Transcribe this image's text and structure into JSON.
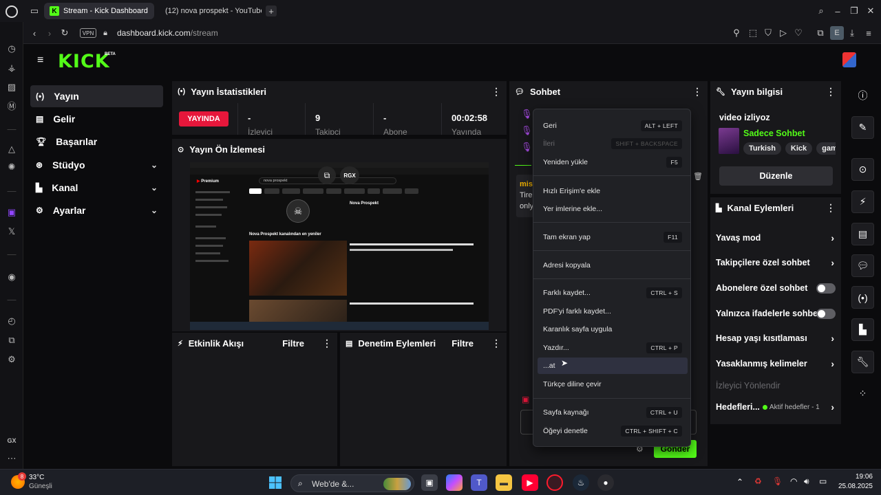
{
  "browser": {
    "tabs": [
      {
        "title": "Stream - Kick Dashboard",
        "active": true
      },
      {
        "title": "(12) nova prospekt - YouTube",
        "active": false
      }
    ],
    "vpn_label": "VPN",
    "url_domain": "dashboard.kick.com",
    "url_path": "/stream",
    "profile_letter": "E",
    "sidebar_bottom_label": "GX"
  },
  "brand": {
    "logo": "KICK",
    "beta": "BETA",
    "accent": "#53fc18"
  },
  "nav": {
    "items": [
      {
        "label": "Yayın",
        "icon": "broadcast-icon",
        "active": true,
        "expandable": false
      },
      {
        "label": "Gelir",
        "icon": "money-icon",
        "active": false,
        "expandable": false
      },
      {
        "label": "Başarılar",
        "icon": "trophy-icon",
        "active": false,
        "expandable": false
      },
      {
        "label": "Stüdyo",
        "icon": "studio-icon",
        "active": false,
        "expandable": true
      },
      {
        "label": "Kanal",
        "icon": "channel-icon",
        "active": false,
        "expandable": true
      },
      {
        "label": "Ayarlar",
        "icon": "gear-icon",
        "active": false,
        "expandable": true
      }
    ]
  },
  "stats": {
    "title": "Yayın İstatistikleri",
    "live_badge": "YAYINDA",
    "cells": [
      {
        "value": "-",
        "label": "İzleyici"
      },
      {
        "value": "9",
        "label": "Takipçi"
      },
      {
        "value": "-",
        "label": "Abone"
      },
      {
        "value": "00:02:58",
        "label": "Yayında"
      }
    ]
  },
  "preview": {
    "title": "Yayın Ön İzlemesi",
    "rgx": "RGX",
    "yt_search": "nova prospekt",
    "yt_channel": "Nova Prospekt",
    "yt_section": "Nova Prospekt kanalından en yeniler",
    "yt_premium": "Premium"
  },
  "activity": {
    "title": "Etkinlik Akışı",
    "filter": "Filtre"
  },
  "moderation": {
    "title": "Denetim Eylemleri",
    "filter": "Filtre"
  },
  "chat": {
    "title": "Sohbet",
    "msg_user": "mis",
    "msg_line1": "Tire",
    "msg_line2": "only",
    "send": "Gönder"
  },
  "context_menu": {
    "items": [
      {
        "label": "Geri",
        "kb": "ALT + LEFT",
        "disabled": false
      },
      {
        "label": "İleri",
        "kb": "SHIFT + BACKSPACE",
        "disabled": true
      },
      {
        "label": "Yeniden yükle",
        "kb": "F5",
        "disabled": false
      },
      {
        "label": "Hızlı Erişim'e ekle",
        "kb": "",
        "disabled": false
      },
      {
        "label": "Yer imlerine ekle...",
        "kb": "",
        "disabled": false
      },
      {
        "label": "Tam ekran yap",
        "kb": "F11",
        "disabled": false
      },
      {
        "label": "Adresi kopyala",
        "kb": "",
        "disabled": false
      },
      {
        "label": "Farklı kaydet...",
        "kb": "CTRL + S",
        "disabled": false
      },
      {
        "label": "PDF'yi farklı kaydet...",
        "kb": "",
        "disabled": false
      },
      {
        "label": "Karanlık sayfa uygula",
        "kb": "",
        "disabled": false
      },
      {
        "label": "Yazdır...",
        "kb": "CTRL + P",
        "disabled": false
      },
      {
        "label": "...at",
        "kb": "",
        "disabled": false
      },
      {
        "label": "Türkçe diline çevir",
        "kb": "",
        "disabled": false
      },
      {
        "label": "Sayfa kaynağı",
        "kb": "CTRL + U",
        "disabled": false
      },
      {
        "label": "Öğeyi denetle",
        "kb": "CTRL + SHIFT + C",
        "disabled": false
      }
    ]
  },
  "stream_info": {
    "title": "Yayın bilgisi",
    "stream_title": "video izliyoz",
    "category": "Sadece Sohbet",
    "tags": [
      "Turkish",
      "Kick",
      "gamin"
    ],
    "edit_button": "Düzenle"
  },
  "channel_actions": {
    "title": "Kanal Eylemleri",
    "items": [
      {
        "label": "Yavaş mod",
        "control": "arrow"
      },
      {
        "label": "Takipçilere özel sohbet",
        "control": "arrow"
      },
      {
        "label": "Abonelere özel sohbet",
        "control": "toggle"
      },
      {
        "label": "Yalnızca ifadelerle sohbet",
        "control": "toggle"
      },
      {
        "label": "Hesap yaşı kısıtlaması",
        "control": "arrow"
      },
      {
        "label": "Yasaklanmış kelimeler",
        "control": "arrow"
      }
    ],
    "redirect": "İzleyici Yönlendir",
    "goals_label": "Hedefleri...",
    "goals_status": "Aktif hedefler - 1"
  },
  "taskbar": {
    "weather_temp": "33°C",
    "weather_desc": "Güneşli",
    "weather_badge": "8",
    "search": "Web'de &...",
    "time": "19:06",
    "date": "25.08.2025"
  }
}
